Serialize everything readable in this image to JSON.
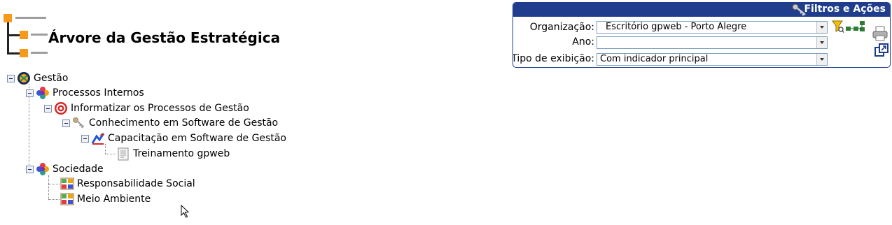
{
  "page": {
    "title": "Árvore da Gestão Estratégica"
  },
  "tree": {
    "root": {
      "label": "Gestão"
    },
    "processos": {
      "label": "Processos Internos"
    },
    "informatizar": {
      "label": "Informatizar os Processos de Gestão"
    },
    "conhecimento": {
      "label": "Conhecimento em Software de Gestão"
    },
    "capacitacao": {
      "label": "Capacitação em Software de Gestão"
    },
    "treinamento": {
      "label": "Treinamento gpweb"
    },
    "sociedade": {
      "label": "Sociedade"
    },
    "responsabilidade": {
      "label": "Responsabilidade Social"
    },
    "meio_ambiente": {
      "label": "Meio Ambiente"
    }
  },
  "filters": {
    "title": "Filtros e Ações",
    "organizacao": {
      "label": "Organização:",
      "value": "Escritório gpweb - Porto Alegre"
    },
    "ano": {
      "label": "Ano:",
      "value": ""
    },
    "tipo": {
      "label": "Tipo de exibição:",
      "value": "Com indicador principal"
    }
  },
  "icons": {
    "title": "hierarchy-tree-icon",
    "gestao": "globe-icon",
    "perspectiva": "puzzle-flower-icon",
    "objetivo": "target-icon",
    "fator": "key-icon",
    "iniciativa": "pencil-chart-icon",
    "acao": "document-icon",
    "tema": "color-grid-icon"
  },
  "colors": {
    "panel_header": "#1f3d8c",
    "accent_orange": "#f79a1c"
  }
}
